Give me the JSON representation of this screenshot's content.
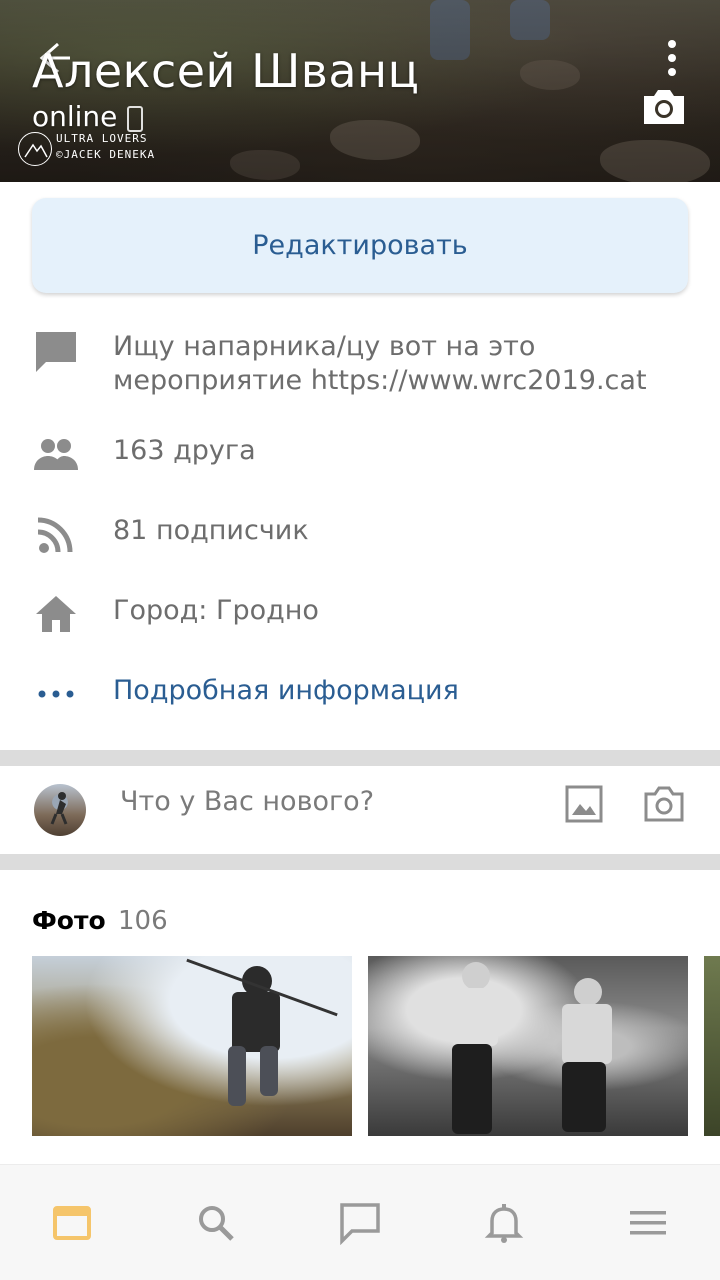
{
  "header": {
    "name": "Алексей Шванц",
    "status": "online",
    "watermark_line1": "ULTRA LOVERS",
    "watermark_line2": "©JACEK DENEKA"
  },
  "actions": {
    "edit_label": "Редактировать"
  },
  "info": {
    "status_text": "Ищу напарника/цу вот на это",
    "status_text_2": "мероприятие https://www.wrc2019.cat",
    "friends": "163 друга",
    "followers": "81 подписчик",
    "city": "Город: Гродно",
    "more_info": "Подробная информация"
  },
  "composer": {
    "placeholder": "Что у Вас нового?"
  },
  "photos": {
    "title": "Фото",
    "count": "106"
  },
  "icons": {
    "back": "arrow-left-icon",
    "more": "more-vertical-icon",
    "camera": "camera-icon",
    "status": "message-icon",
    "friends": "people-icon",
    "followers": "rss-icon",
    "city": "home-icon",
    "more_info": "dots-icon",
    "image": "image-icon",
    "nav_feed": "feed-icon",
    "nav_search": "search-icon",
    "nav_messages": "message-icon",
    "nav_notifications": "bell-icon",
    "nav_menu": "menu-icon"
  },
  "colors": {
    "accent": "#2a5d92",
    "edit_bg": "#e5f1fb",
    "icon_gray": "#8c8c8c",
    "active_nav": "#f5c56b"
  }
}
